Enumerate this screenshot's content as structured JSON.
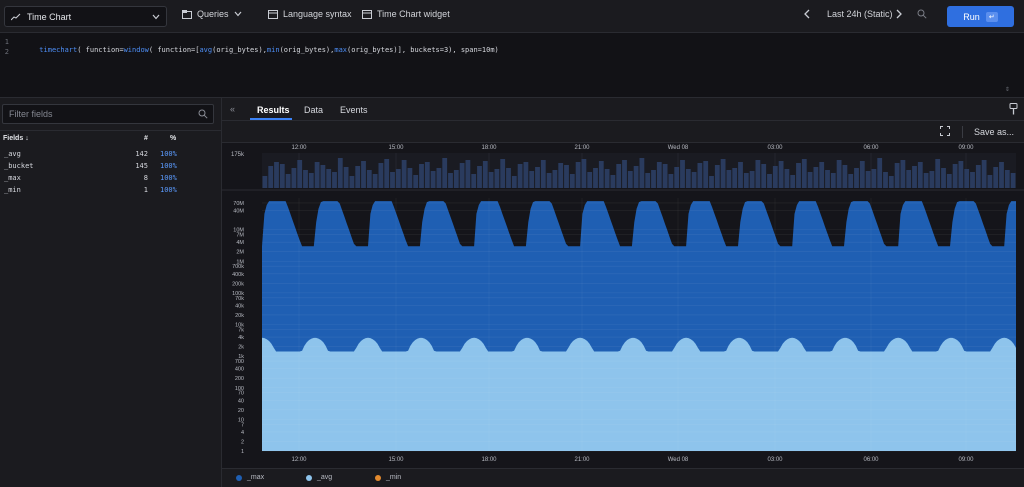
{
  "toolbar": {
    "widget_select": "Time Chart",
    "queries_label": "Queries",
    "language_syntax_label": "Language syntax",
    "time_chart_widget_label": "Time Chart widget",
    "time_range": "Last 24h (Static)",
    "run_label": "Run",
    "run_shortcut": "↵"
  },
  "editor": {
    "line1_num": "1",
    "line2_num": "2",
    "code_fn": "timechart",
    "code_a": "( function=",
    "code_window": "window",
    "code_b": "( function=[",
    "code_avg": "avg",
    "code_c": "(orig_bytes),",
    "code_min": "min",
    "code_d": "(orig_bytes),",
    "code_max": "max",
    "code_e": "(orig_bytes)], buckets=3), span=10m)"
  },
  "left_panel": {
    "filter_placeholder": "Filter fields",
    "col_fields": "Fields",
    "col_count": "#",
    "col_pct": "%",
    "fields": [
      {
        "name": "_avg",
        "count": "142",
        "pct": "100%"
      },
      {
        "name": "_bucket",
        "count": "145",
        "pct": "100%"
      },
      {
        "name": "_max",
        "count": "8",
        "pct": "100%"
      },
      {
        "name": "_min",
        "count": "1",
        "pct": "100%"
      }
    ]
  },
  "tabs": {
    "results": "Results",
    "data": "Data",
    "events": "Events"
  },
  "subbar": {
    "save_as": "Save as..."
  },
  "colors": {
    "max_series": "#1f5fb3",
    "avg_series": "#8ec4ec",
    "min_series": "#e38a2e",
    "accent": "#2f6fe0"
  },
  "chart_data": [
    {
      "type": "bar",
      "description_scope": "overview histogram",
      "x_tick_labels": [
        "12:00",
        "15:00",
        "18:00",
        "21:00",
        "Wed 08",
        "03:00",
        "06:00",
        "09:00"
      ],
      "y_tick_labels": [
        "175k"
      ],
      "ylim": [
        0,
        175000
      ],
      "values": [
        60000,
        110000,
        130000,
        120000,
        70000,
        100000,
        140000,
        90000,
        75000,
        130000,
        115000,
        95000,
        80000,
        150000,
        105000,
        60000,
        110000,
        135000,
        90000,
        70000,
        125000,
        145000,
        80000,
        95000,
        140000,
        100000,
        65000,
        120000,
        130000,
        85000,
        100000,
        150000,
        75000,
        90000,
        125000,
        140000,
        70000,
        110000,
        135000,
        80000,
        95000,
        145000,
        100000,
        60000,
        120000,
        130000,
        85000,
        105000,
        140000,
        75000,
        90000,
        125000,
        115000,
        70000,
        130000,
        145000,
        80000,
        100000,
        135000,
        95000,
        65000,
        120000,
        140000,
        85000,
        110000,
        150000,
        75000,
        90000,
        130000,
        120000,
        70000,
        105000,
        140000,
        95000,
        80000,
        125000,
        135000,
        60000,
        115000,
        145000,
        90000,
        100000,
        130000,
        75000,
        85000,
        140000,
        120000,
        70000,
        110000,
        135000,
        95000,
        65000,
        125000,
        145000,
        80000,
        105000,
        130000,
        90000,
        75000,
        140000,
        115000,
        70000,
        100000,
        135000,
        85000,
        95000,
        150000,
        80000,
        60000,
        125000,
        140000,
        90000,
        110000,
        130000,
        75000,
        85000,
        145000,
        100000,
        70000,
        120000,
        135000,
        95000,
        80000,
        115000,
        140000,
        65000,
        105000,
        130000,
        90000,
        75000
      ]
    },
    {
      "type": "area",
      "scale": "log",
      "x_tick_labels": [
        "12:00",
        "15:00",
        "18:00",
        "21:00",
        "Wed 08",
        "03:00",
        "06:00",
        "09:00"
      ],
      "y_tick_labels": [
        "1",
        "2",
        "4",
        "7",
        "10",
        "20",
        "40",
        "70",
        "100",
        "200",
        "400",
        "700",
        "1k",
        "2k",
        "4k",
        "7k",
        "10k",
        "20k",
        "40k",
        "70k",
        "100k",
        "200k",
        "400k",
        "700k",
        "1M",
        "2M",
        "4M",
        "7M",
        "10M",
        "40M",
        "70M"
      ],
      "ylim": [
        1,
        100000000
      ],
      "x_range": [
        "11:00",
        "10:20"
      ],
      "series": [
        {
          "name": "_max",
          "color": "#1f5fb3",
          "shape": "periodic peaks ~80M, troughs ~3M, period ~1.5h"
        },
        {
          "name": "_avg",
          "color": "#8ec4ec",
          "shape": "periodic oscillation between ~1k and ~4k"
        },
        {
          "name": "_min",
          "color": "#e38a2e",
          "shape": "near 1"
        }
      ],
      "legend": [
        "_max",
        "_avg",
        "_min"
      ],
      "legend_placement": "bottom-left"
    }
  ]
}
